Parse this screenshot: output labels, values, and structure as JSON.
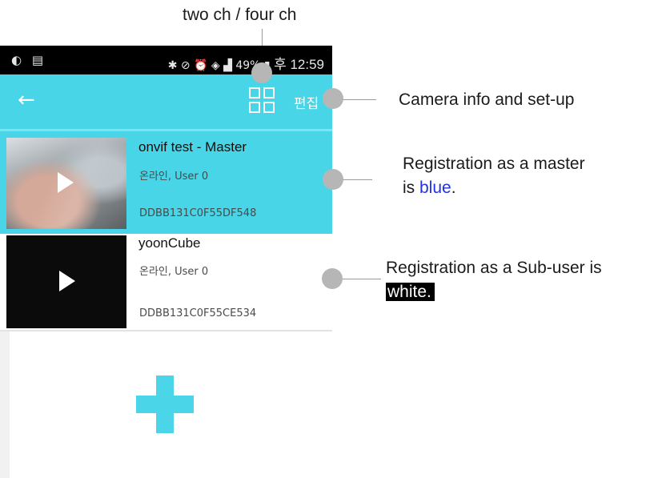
{
  "annotations": {
    "top_label": "two ch / four ch",
    "camera_label": "Camera info and set-up",
    "master_line1": "Registration as a master",
    "master_line2_prefix": "is ",
    "master_line2_blue": "blue",
    "master_line2_suffix": ".",
    "sub_line1": "Registration as a Sub-user is",
    "sub_line2": "white."
  },
  "status_bar": {
    "left_icons": "◐ ▤",
    "right_icons": "✱ ⊘ ⏰ ◈ ▟ 49% ▮",
    "time": "후 12:59"
  },
  "app_bar": {
    "back_icon": "←",
    "edit_label": "편집"
  },
  "devices": [
    {
      "title": "onvif test - Master",
      "status": "온라인, User 0",
      "id": "DDBB131C0F55DF548",
      "role": "master"
    },
    {
      "title": "yoonCube",
      "status": "온라인, User 0",
      "id": "DDBB131C0F55CE534",
      "role": "sub-user"
    }
  ],
  "colors": {
    "accent": "#47d5e7",
    "master_text": "#2230e6"
  }
}
